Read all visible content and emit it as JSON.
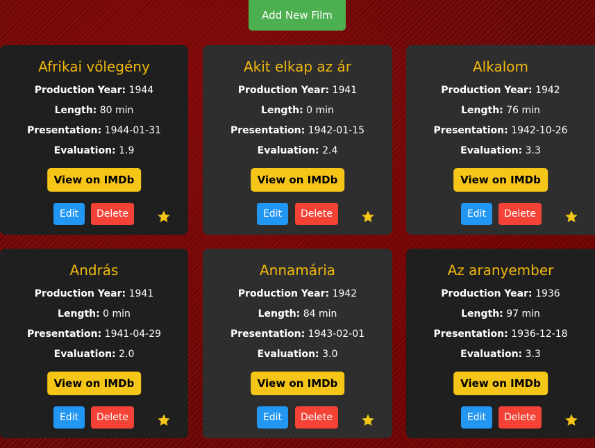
{
  "header": {
    "add_button_label": "Add New Film"
  },
  "labels": {
    "production_year": "Production Year:",
    "length": "Length:",
    "presentation": "Presentation:",
    "evaluation": "Evaluation:",
    "imdb_button": "View on IMDb",
    "edit_button": "Edit",
    "delete_button": "Delete"
  },
  "colors": {
    "title": "#f0b90b",
    "add_button": "#4caf50",
    "imdb_button": "#f5c518",
    "edit_button": "#2196f3",
    "delete_button": "#f44336",
    "star": "#f5c518"
  },
  "films": [
    {
      "title": "Afrikai vőlegény",
      "production_year": "1944",
      "length": "80 min",
      "presentation": "1944-01-31",
      "evaluation": "1.9",
      "favorite_icon": "star-icon"
    },
    {
      "title": "Akit elkap az ár",
      "production_year": "1941",
      "length": "0 min",
      "presentation": "1942-01-15",
      "evaluation": "2.4",
      "favorite_icon": "star-icon"
    },
    {
      "title": "Alkalom",
      "production_year": "1942",
      "length": "76 min",
      "presentation": "1942-10-26",
      "evaluation": "3.3",
      "favorite_icon": "star-icon"
    },
    {
      "title": "András",
      "production_year": "1941",
      "length": "0 min",
      "presentation": "1941-04-29",
      "evaluation": "2.0",
      "favorite_icon": "star-icon"
    },
    {
      "title": "Annamária",
      "production_year": "1942",
      "length": "84 min",
      "presentation": "1943-02-01",
      "evaluation": "3.0",
      "favorite_icon": "star-icon"
    },
    {
      "title": "Az aranyember",
      "production_year": "1936",
      "length": "97 min",
      "presentation": "1936-12-18",
      "evaluation": "3.3",
      "favorite_icon": "star-icon"
    }
  ]
}
